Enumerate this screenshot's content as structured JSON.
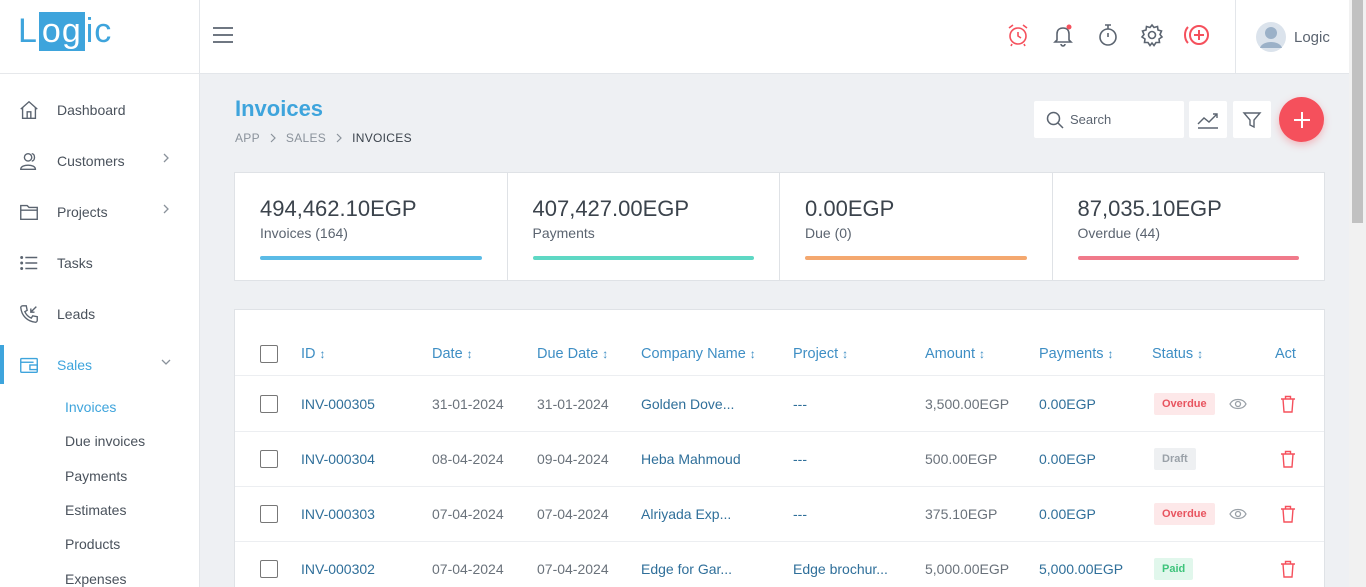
{
  "app": {
    "logo_prefix": "L",
    "logo_box": "og",
    "logo_suffix": "ic"
  },
  "sidebar": {
    "items": [
      {
        "label": "Dashboard",
        "icon": "home-icon"
      },
      {
        "label": "Customers",
        "icon": "users-icon",
        "has_chevron": true
      },
      {
        "label": "Projects",
        "icon": "folder-icon",
        "has_chevron": true
      },
      {
        "label": "Tasks",
        "icon": "list-icon"
      },
      {
        "label": "Leads",
        "icon": "phone-icon"
      },
      {
        "label": "Sales",
        "icon": "wallet-icon",
        "has_chevron": true,
        "active": true
      }
    ],
    "sales_sub": [
      "Invoices",
      "Due invoices",
      "Payments",
      "Estimates",
      "Products",
      "Expenses"
    ]
  },
  "topbar": {
    "user_name": "Logic",
    "accent_red": "#f5505c"
  },
  "page": {
    "title": "Invoices",
    "breadcrumb": [
      "APP",
      "SALES",
      "INVOICES"
    ],
    "search_placeholder": "Search"
  },
  "stats": [
    {
      "amount": "494,462.10EGP",
      "label": "Invoices (164)",
      "color": "#5bbbe6"
    },
    {
      "amount": "407,427.00EGP",
      "label": "Payments",
      "color": "#5ed8c4"
    },
    {
      "amount": "0.00EGP",
      "label": "Due (0)",
      "color": "#f4a86f"
    },
    {
      "amount": "87,035.10EGP",
      "label": "Overdue (44)",
      "color": "#f07a8a"
    }
  ],
  "table": {
    "headers": [
      "ID",
      "Date",
      "Due Date",
      "Company Name",
      "Project",
      "Amount",
      "Payments",
      "Status",
      "Act"
    ],
    "sort_glyph": "↕",
    "rows": [
      {
        "id": "INV-000305",
        "date": "31-01-2024",
        "due": "31-01-2024",
        "company": "Golden Dove...",
        "project": "---",
        "amount": "3,500.00EGP",
        "payments": "0.00EGP",
        "status": "Overdue",
        "status_class": "s-overdue",
        "view": true
      },
      {
        "id": "INV-000304",
        "date": "08-04-2024",
        "due": "09-04-2024",
        "company": "Heba Mahmoud",
        "project": "---",
        "amount": "500.00EGP",
        "payments": "0.00EGP",
        "status": "Draft",
        "status_class": "s-draft",
        "view": false
      },
      {
        "id": "INV-000303",
        "date": "07-04-2024",
        "due": "07-04-2024",
        "company": "Alriyada Exp...",
        "project": "---",
        "amount": "375.10EGP",
        "payments": "0.00EGP",
        "status": "Overdue",
        "status_class": "s-overdue",
        "view": true
      },
      {
        "id": "INV-000302",
        "date": "07-04-2024",
        "due": "07-04-2024",
        "company": "Edge for Gar...",
        "project": "Edge brochur...",
        "amount": "5,000.00EGP",
        "payments": "5,000.00EGP",
        "status": "Paid",
        "status_class": "s-paid",
        "view": false
      }
    ]
  }
}
